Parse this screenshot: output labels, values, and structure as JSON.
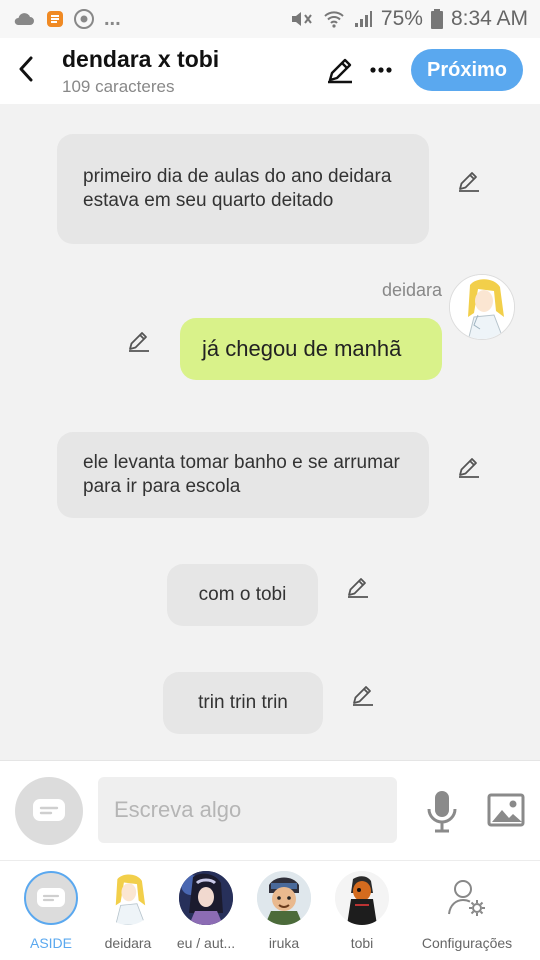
{
  "status_bar": {
    "battery": "75%",
    "time": "8:34 AM",
    "overflow": "..."
  },
  "header": {
    "title": "dendara x tobi",
    "subtitle": "109 caracteres",
    "next_label": "Próximo"
  },
  "messages": [
    {
      "type": "narration",
      "text": "primeiro dia de aulas  do ano deidara  estava em seu quarto deitado"
    },
    {
      "type": "character",
      "speaker": "deidara",
      "text": "já chegou de manhã"
    },
    {
      "type": "narration",
      "text": "ele levanta tomar banho e se arrumar para ir para escola"
    },
    {
      "type": "narration",
      "text": "com o tobi"
    },
    {
      "type": "narration",
      "text": "trin trin trin"
    }
  ],
  "composer": {
    "placeholder": "Escreva algo"
  },
  "bottom_nav": [
    {
      "label": "ASIDE"
    },
    {
      "label": "deidara"
    },
    {
      "label": "eu / aut..."
    },
    {
      "label": "iruka"
    },
    {
      "label": "tobi"
    },
    {
      "label": "Configurações"
    }
  ],
  "colors": {
    "accent": "#5aa8ef",
    "bubble_gray": "#e6e6e6",
    "bubble_green": "#d9f28a",
    "background": "#f2f2f2"
  }
}
